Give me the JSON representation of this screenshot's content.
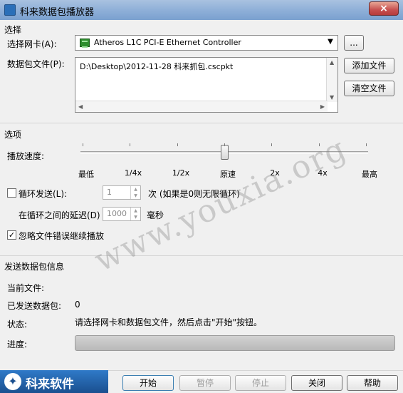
{
  "window": {
    "title": "科来数据包播放器",
    "close_glyph": "×"
  },
  "select_section": {
    "heading": "选择",
    "nic_label": "选择网卡(A):",
    "nic_value": "Atheros L1C PCI-E Ethernet Controller",
    "browse_label": "...",
    "file_label": "数据包文件(P):",
    "file_value": "D:\\Desktop\\2012-11-28 科来抓包.cscpkt",
    "add_file_label": "添加文件",
    "clear_file_label": "清空文件"
  },
  "options_section": {
    "heading": "选项",
    "speed_label": "播放速度:",
    "speed_ticks": [
      "最低",
      "1/4x",
      "1/2x",
      "原速",
      "2x",
      "4x",
      "最高"
    ],
    "speed_selected_index": 3,
    "loop_label": "循环发送(L):",
    "loop_checked": false,
    "loop_value": "1",
    "loop_hint": "次 (如果是0则无限循环)",
    "delay_label": "在循环之间的延迟(D)",
    "delay_value": "1000",
    "delay_unit": "毫秒",
    "ignore_errors_label": "忽略文件错误继续播放",
    "ignore_errors_checked": true
  },
  "info_section": {
    "heading": "发送数据包信息",
    "current_file_label": "当前文件:",
    "current_file_value": "",
    "sent_label": "已发送数据包:",
    "sent_value": "0",
    "status_label": "状态:",
    "status_value": "请选择网卡和数据包文件，然后点击\"开始\"按钮。",
    "progress_label": "进度:",
    "progress_value": 0
  },
  "footer": {
    "logo_text": "科来软件",
    "start_label": "开始",
    "pause_label": "暂停",
    "stop_label": "停止",
    "close_label": "关闭",
    "help_label": "帮助"
  },
  "watermark": {
    "text": "www.youxia.org"
  }
}
